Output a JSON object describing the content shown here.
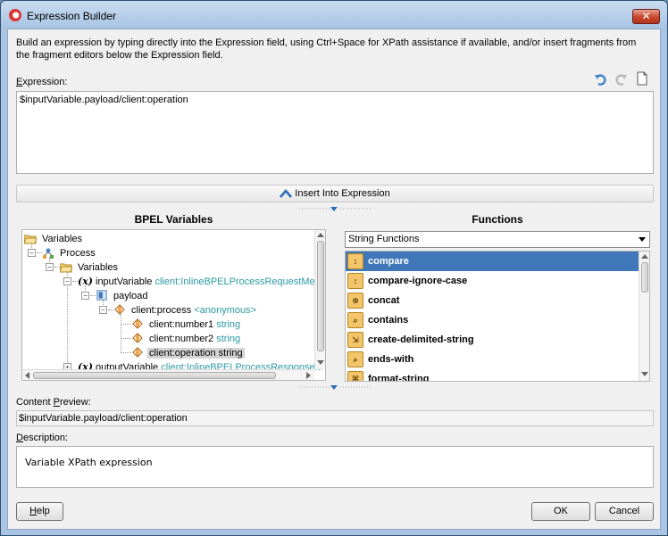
{
  "window": {
    "title": "Expression Builder",
    "close_glyph": "✕"
  },
  "intro": "Build an expression by typing directly into the Expression field, using Ctrl+Space for XPath assistance if available, and/or insert fragments from the fragment editors below the Expression field.",
  "expression": {
    "label_pre": "",
    "label_mnemonic": "E",
    "label_post": "xpression:",
    "value": "$inputVariable.payload/client:operation",
    "toolbar": [
      "undo-icon",
      "redo-icon",
      "clear-icon"
    ]
  },
  "insert_button": "Insert Into Expression",
  "bpel_variables": {
    "heading": "BPEL Variables",
    "tree": {
      "root": "Variables",
      "process": "Process",
      "variables": "Variables",
      "input_variable": {
        "name": "inputVariable",
        "type": "client:InlineBPELProcessRequestMess"
      },
      "payload": "payload",
      "client_process": {
        "name": "client:process",
        "type": "<anonymous>"
      },
      "number1": {
        "name": "client:number1",
        "type": "string"
      },
      "number2": {
        "name": "client:number2",
        "type": "string"
      },
      "operation": {
        "name": "client:operation",
        "type": "string"
      },
      "output_variable": {
        "name": "outputVariable",
        "type": "client:InlineBPELProcessResponseM"
      }
    }
  },
  "functions": {
    "heading": "Functions",
    "category": "String Functions",
    "items": [
      {
        "name": "compare",
        "selected": true
      },
      {
        "name": "compare-ignore-case",
        "selected": false
      },
      {
        "name": "concat",
        "selected": false
      },
      {
        "name": "contains",
        "selected": false
      },
      {
        "name": "create-delimited-string",
        "selected": false
      },
      {
        "name": "ends-with",
        "selected": false
      },
      {
        "name": "format-string",
        "selected": false
      }
    ]
  },
  "content_preview": {
    "label_pre": "Content ",
    "label_mnemonic": "P",
    "label_post": "review:",
    "value": "$inputVariable.payload/client:operation"
  },
  "description": {
    "label_pre": "",
    "label_mnemonic": "D",
    "label_post": "escription:",
    "value": "Variable XPath expression"
  },
  "buttons": {
    "help_mnemonic": "H",
    "help_rest": "elp",
    "ok": "OK",
    "cancel": "Cancel"
  },
  "colors": {
    "selection": "#3f77b8",
    "type_text": "#2b9aa3",
    "icon_orange": "#f4c46a"
  }
}
